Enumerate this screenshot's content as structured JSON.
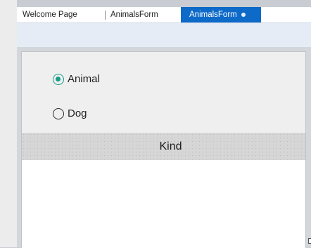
{
  "tabs": [
    {
      "label": "Welcome Page"
    },
    {
      "label": "AnimalsForm"
    },
    {
      "label": "AnimalsForm",
      "active": true
    }
  ],
  "form": {
    "radio_options": [
      {
        "label": "Animal",
        "checked": true
      },
      {
        "label": "Dog",
        "checked": false
      }
    ],
    "kind_label": "Kind"
  },
  "colors": {
    "active_tab": "#0e6ac9",
    "radio_accent": "#169c88"
  }
}
